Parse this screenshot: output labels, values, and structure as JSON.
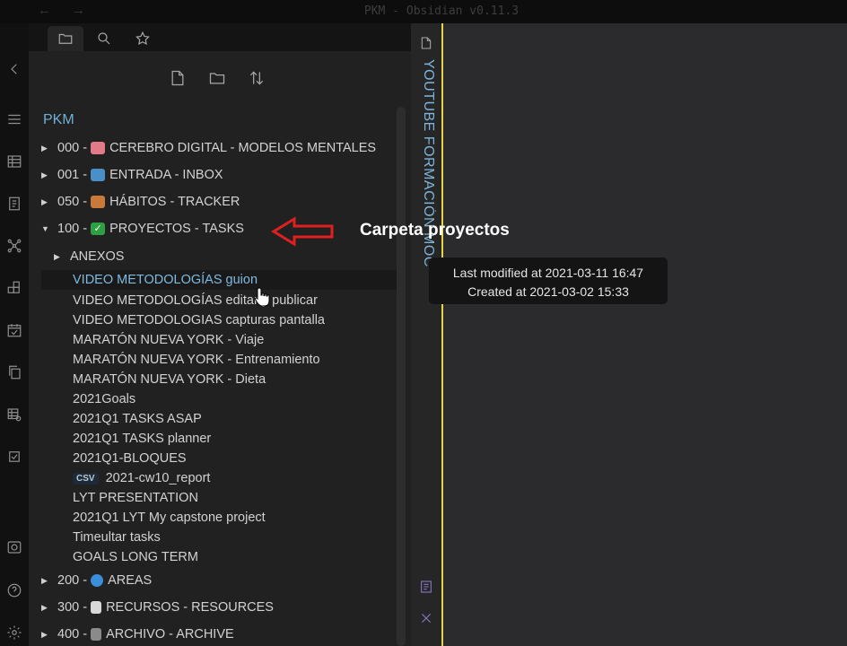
{
  "window": {
    "title": "PKM - Obsidian v0.11.3",
    "back_arrow": "←",
    "forward_arrow": "→"
  },
  "left_ribbon": {
    "icons": [
      "chevron-left-icon",
      "menu-icon",
      "table-icon",
      "book-icon",
      "graph-icon",
      "blocks-icon",
      "calendar-check-icon",
      "copy-icon",
      "table-settings-icon",
      "checkbox-icon",
      "vault-icon",
      "help-icon",
      "settings-icon"
    ]
  },
  "sidebar_tabs": [
    "folder-icon",
    "search-icon",
    "star-icon"
  ],
  "explorer": {
    "toolbar": [
      "new-note-icon",
      "new-folder-icon",
      "sort-icon"
    ],
    "vault_name": "PKM",
    "folders_top": [
      {
        "prefix": "000 - ",
        "emoji": "🧠",
        "label": "CEREBRO DIGITAL - MODELOS MENTALES",
        "emoji_color": "#e27a8a"
      },
      {
        "prefix": "001 - ",
        "emoji": "📥",
        "label": "ENTRADA - INBOX",
        "emoji_color": "#4a90c8"
      },
      {
        "prefix": "050 - ",
        "emoji": "🧺",
        "label": "HÁBITOS - TRACKER",
        "emoji_color": "#c77a3a"
      },
      {
        "prefix": "100 - ",
        "emoji": "✅",
        "label": "PROYECTOS - TASKS",
        "emoji_color": "#2ea043"
      }
    ],
    "subfolder": "ANEXOS",
    "files": [
      {
        "label": "VIDEO METODOLOGÍAS guion",
        "selected": true
      },
      {
        "label": "VIDEO METODOLOGÍAS editar y publicar"
      },
      {
        "label": "VIDEO METODOLOGIAS capturas pantalla"
      },
      {
        "label": "MARATÓN NUEVA YORK - Viaje"
      },
      {
        "label": "MARATÓN NUEVA YORK - Entrenamiento"
      },
      {
        "label": "MARATÓN NUEVA YORK - Dieta"
      },
      {
        "label": "2021Goals"
      },
      {
        "label": "2021Q1 TASKS ASAP"
      },
      {
        "label": "2021Q1 TASKS planner"
      },
      {
        "label": "2021Q1-BLOQUES"
      },
      {
        "label": "2021-cw10_report",
        "badge": "CSV"
      },
      {
        "label": "LYT PRESENTATION"
      },
      {
        "label": "2021Q1 LYT My capstone project"
      },
      {
        "label": "Timeultar tasks"
      },
      {
        "label": "GOALS LONG TERM"
      }
    ],
    "folders_bottom": [
      {
        "prefix": "200 - ",
        "emoji": "🌍",
        "label": "AREAS",
        "emoji_color": "#3c8ed8"
      },
      {
        "prefix": "300 - ",
        "emoji": "📄",
        "label": "RECURSOS - RESOURCES",
        "emoji_color": "#d8d8d8"
      },
      {
        "prefix": "400 - ",
        "emoji": "🗑️",
        "label": "ARCHIVO - ARCHIVE",
        "emoji_color": "#8a8a8a"
      }
    ]
  },
  "right_pane": {
    "vertical_title": "YOUTUBE FORMACIÓN MOC"
  },
  "annotation": {
    "text": "Carpeta proyectos",
    "arrow_color": "#e02020"
  },
  "tooltip": {
    "modified": "Last modified at 2021-03-11 16:47",
    "created": "Created at 2021-03-02 15:33"
  }
}
